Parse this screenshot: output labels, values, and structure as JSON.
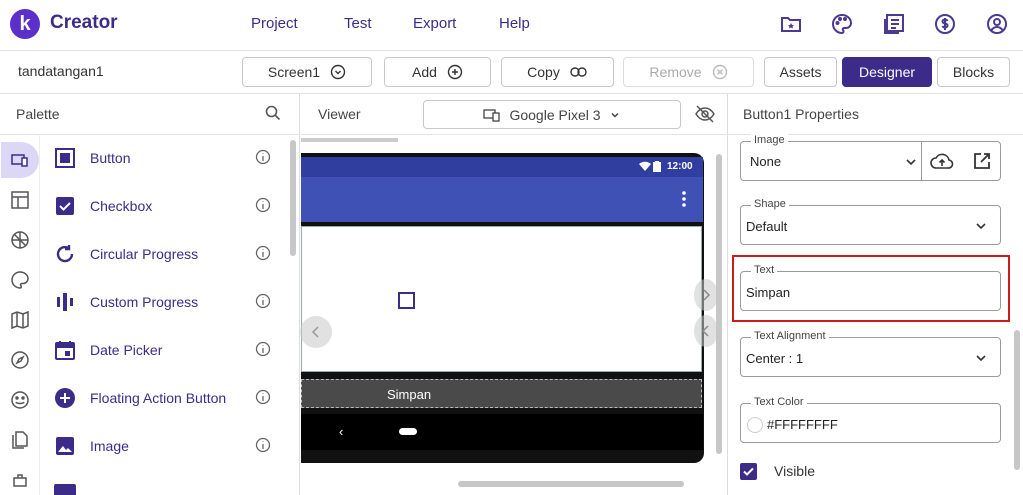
{
  "app": {
    "logo_letter": "k",
    "brand": "Creator"
  },
  "menu": [
    "Project",
    "Test",
    "Export",
    "Help"
  ],
  "top_icons": [
    "folder-star-icon",
    "palette-icon",
    "news-icon",
    "dollar-icon",
    "account-icon"
  ],
  "toolbar": {
    "project_name": "tandatangan1",
    "screen_label": "Screen1",
    "add_label": "Add",
    "copy_label": "Copy",
    "remove_label": "Remove",
    "assets_label": "Assets",
    "designer_label": "Designer",
    "blocks_label": "Blocks"
  },
  "palette": {
    "title": "Palette",
    "items": [
      {
        "label": "Button",
        "icon": "button-icon"
      },
      {
        "label": "Checkbox",
        "icon": "checkbox-icon"
      },
      {
        "label": "Circular Progress",
        "icon": "circular-progress-icon"
      },
      {
        "label": "Custom Progress",
        "icon": "custom-progress-icon"
      },
      {
        "label": "Date Picker",
        "icon": "date-picker-icon"
      },
      {
        "label": "Floating Action Button",
        "icon": "fab-icon"
      },
      {
        "label": "Image",
        "icon": "image-icon"
      }
    ]
  },
  "viewer": {
    "title": "Viewer",
    "device": "Google Pixel 3",
    "status_time": "12:00",
    "button_text": "Simpan"
  },
  "properties": {
    "title": "Button1 Properties",
    "image": {
      "label": "Image",
      "value": "None"
    },
    "shape": {
      "label": "Shape",
      "value": "Default"
    },
    "text": {
      "label": "Text",
      "value": "Simpan"
    },
    "text_alignment": {
      "label": "Text Alignment",
      "value": "Center : 1"
    },
    "text_color": {
      "label": "Text Color",
      "value": "#FFFFFFFF"
    },
    "visible": {
      "label": "Visible",
      "checked": true
    }
  },
  "colors": {
    "accent": "#3d2b8a",
    "app_bar": "#3f51b5",
    "highlight": "#d0191b"
  }
}
